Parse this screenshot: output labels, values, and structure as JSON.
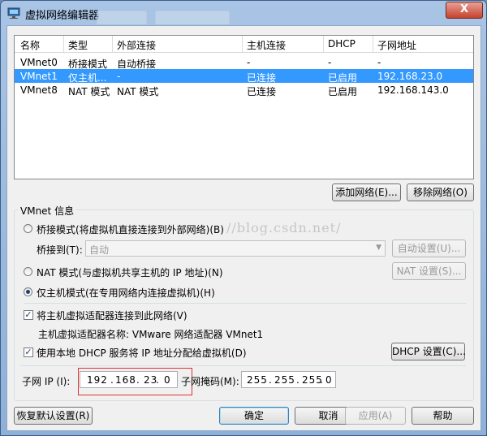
{
  "window": {
    "title": "虚拟网络编辑器",
    "close_label": "X"
  },
  "table": {
    "headers": [
      "名称",
      "类型",
      "外部连接",
      "主机连接",
      "DHCP",
      "子网地址"
    ],
    "rows": [
      {
        "name": "VMnet0",
        "type": "桥接模式",
        "external": "自动桥接",
        "host": "-",
        "dhcp": "-",
        "subnet": "-"
      },
      {
        "name": "VMnet1",
        "type": "仅主机...",
        "external": "-",
        "host": "已连接",
        "dhcp": "已启用",
        "subnet": "192.168.23.0"
      },
      {
        "name": "VMnet8",
        "type": "NAT 模式",
        "external": "NAT 模式",
        "host": "已连接",
        "dhcp": "已启用",
        "subnet": "192.168.143.0"
      }
    ],
    "selected_index": 1
  },
  "buttons": {
    "add_network": "添加网络(E)...",
    "remove_network": "移除网络(O)",
    "auto_settings": "自动设置(U)...",
    "nat_settings": "NAT 设置(S)...",
    "dhcp_settings": "DHCP 设置(C)...",
    "restore_defaults": "恢复默认设置(R)",
    "ok": "确定",
    "cancel": "取消",
    "apply": "应用(A)",
    "help": "帮助"
  },
  "vmnet_info": {
    "legend": "VMnet 信息",
    "bridged_label": "桥接模式(将虚拟机直接连接到外部网络)(B)",
    "bridge_to_label": "桥接到(T):",
    "bridge_to_value": "自动",
    "nat_label": "NAT 模式(与虚拟机共享主机的 IP 地址)(N)",
    "hostonly_label": "仅主机模式(在专用网络内连接虚拟机)(H)",
    "selected_mode": "hostonly",
    "connect_adapter_label": "将主机虚拟适配器连接到此网络(V)",
    "connect_adapter_checked": true,
    "adapter_name_label": "主机虚拟适配器名称: VMware 网络适配器 VMnet1",
    "use_dhcp_label": "使用本地 DHCP 服务将 IP 地址分配给虚拟机(D)",
    "use_dhcp_checked": true,
    "subnet_ip_label": "子网 IP (I):",
    "subnet_ip": [
      "192",
      "168",
      "23",
      "0"
    ],
    "subnet_mask_label": "子网掩码(M):",
    "subnet_mask": [
      "255",
      "255",
      "255",
      "0"
    ]
  },
  "watermark": "//blog.csdn.net/",
  "colors": {
    "selection": "#3399ff",
    "highlight_box": "#e03030"
  }
}
